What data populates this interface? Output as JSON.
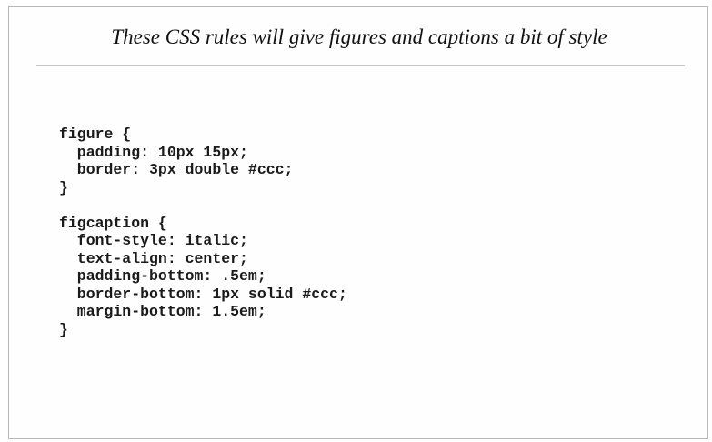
{
  "figure": {
    "caption": "These CSS rules will give figures and captions a bit of style",
    "code_lines": [
      "figure {",
      "  padding: 10px 15px;",
      "  border: 3px double #ccc;",
      "}",
      "",
      "figcaption {",
      "  font-style: italic;",
      "  text-align: center;",
      "  padding-bottom: .5em;",
      "  border-bottom: 1px solid #ccc;",
      "  margin-bottom: 1.5em;",
      "}"
    ]
  }
}
